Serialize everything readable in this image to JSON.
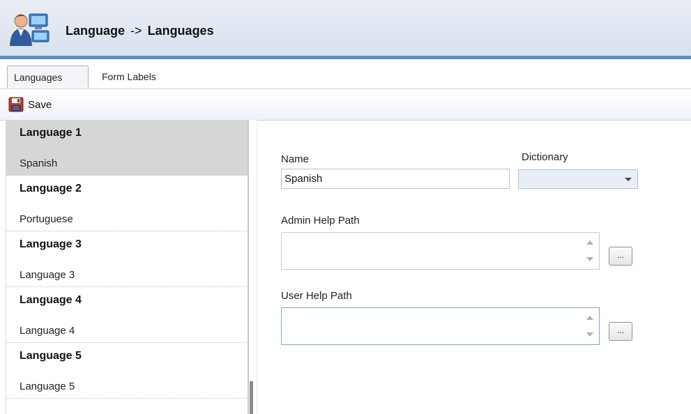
{
  "header": {
    "title_part1": "Language",
    "arrow": "->",
    "title_part2": "Languages",
    "icon": "users-computer-icon"
  },
  "tabs": [
    {
      "label": "Languages",
      "active": true
    },
    {
      "label": "Form Labels",
      "active": false
    }
  ],
  "toolbar": {
    "save_label": "Save",
    "save_icon": "floppy-disk-icon"
  },
  "languages": [
    {
      "title": "Language 1",
      "value": "Spanish",
      "selected": true
    },
    {
      "title": "Language 2",
      "value": "Portuguese",
      "selected": false
    },
    {
      "title": "Language 3",
      "value": "Language 3",
      "selected": false
    },
    {
      "title": "Language 4",
      "value": "Language 4",
      "selected": false
    },
    {
      "title": "Language 5",
      "value": "Language 5",
      "selected": false
    }
  ],
  "form": {
    "name_label": "Name",
    "name_value": "Spanish",
    "dictionary_label": "Dictionary",
    "dictionary_value": "",
    "admin_help_label": "Admin Help Path",
    "admin_help_value": "",
    "user_help_label": "User Help Path",
    "user_help_value": "",
    "browse_label": "..."
  },
  "colors": {
    "header_accent": "#5f8ac6",
    "selected_row": "#d6d6d6"
  }
}
